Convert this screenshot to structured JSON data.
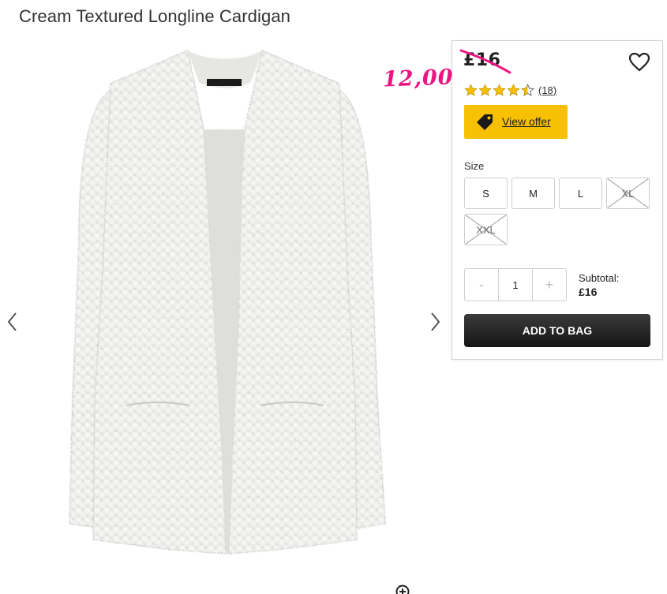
{
  "product": {
    "title": "Cream Textured Longline Cardigan"
  },
  "gallery": {
    "prev_icon": "chevron-left-icon",
    "next_icon": "chevron-right-icon",
    "zoom_icon": "zoom-in-icon",
    "image_subject": "cream textured longline cardigan"
  },
  "price": {
    "original": "£16",
    "sale": "12,00",
    "sale_color": "#ec1581"
  },
  "rating": {
    "value": 4.5,
    "max": 5,
    "count_text": "(18)",
    "star_color": "#f7c002"
  },
  "offer": {
    "label": "View offer",
    "icon": "tag-icon",
    "color": "#f7c002"
  },
  "sizes": {
    "label": "Size",
    "options": [
      {
        "label": "S",
        "available": true
      },
      {
        "label": "M",
        "available": true
      },
      {
        "label": "L",
        "available": true
      },
      {
        "label": "XL",
        "available": false
      },
      {
        "label": "XXL",
        "available": false
      }
    ]
  },
  "quantity": {
    "minus": "-",
    "value": "1",
    "plus": "+"
  },
  "subtotal": {
    "label": "Subtotal:",
    "value": "£16"
  },
  "add_to_bag": {
    "label": "ADD TO BAG"
  }
}
